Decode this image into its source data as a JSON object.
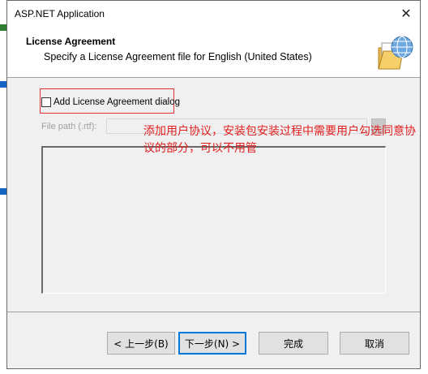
{
  "window": {
    "title": "ASP.NET Application",
    "close_glyph": "✕"
  },
  "header": {
    "title": "License Agreement",
    "subtitle": "Specify a License Agreement file for English (United States)",
    "icon": "folder-globe-icon"
  },
  "form": {
    "checkbox_label": "Add License Agreement dialog",
    "checkbox_checked": false,
    "file_path_label": "File path (.rtf):",
    "file_path_value": ""
  },
  "annotation": {
    "text": "添加用户协议，安装包安装过程中需要用户勾选同意协议的部分，可以不用管",
    "color": "#e02020"
  },
  "buttons": {
    "back": "< 上一步(B)",
    "next": "下一步(N) >",
    "finish": "完成",
    "cancel": "取消"
  },
  "colors": {
    "accent": "#0078d7",
    "highlight_box": "#e03030",
    "panel_bg": "#f0f0f0"
  }
}
